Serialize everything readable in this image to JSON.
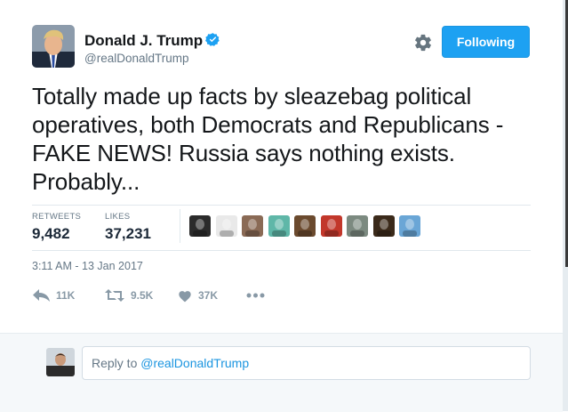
{
  "author": {
    "name": "Donald J. Trump",
    "handle": "@realDonaldTrump",
    "verified": true
  },
  "follow_button": {
    "label": "Following"
  },
  "tweet": {
    "text": "Totally made up facts by sleazebag political operatives, both Democrats and Republicans - FAKE NEWS! Russia says nothing exists. Probably...",
    "timestamp": "3:11 AM - 13 Jan 2017"
  },
  "stats": {
    "retweets_label": "RETWEETS",
    "retweets": "9,482",
    "likes_label": "LIKES",
    "likes": "37,231"
  },
  "likers": [
    {
      "name": "liker-1",
      "color": "#2b2b2b"
    },
    {
      "name": "liker-2",
      "color": "#e9e9e9"
    },
    {
      "name": "liker-3",
      "color": "#8a6a55"
    },
    {
      "name": "liker-4",
      "color": "#5fb7a8"
    },
    {
      "name": "liker-5",
      "color": "#6b4a2e"
    },
    {
      "name": "liker-6",
      "color": "#c2372b"
    },
    {
      "name": "liker-7",
      "color": "#7c8a80"
    },
    {
      "name": "liker-8",
      "color": "#3b2a1a"
    },
    {
      "name": "liker-9",
      "color": "#6aa6d6"
    }
  ],
  "actions": {
    "reply_count": "11K",
    "retweet_count": "9.5K",
    "like_count": "37K"
  },
  "reply_box": {
    "prefix": "Reply to ",
    "mention": "@realDonaldTrump"
  },
  "colors": {
    "accent": "#1da1f2",
    "muted": "#657786",
    "action_gray": "#8899a6"
  }
}
